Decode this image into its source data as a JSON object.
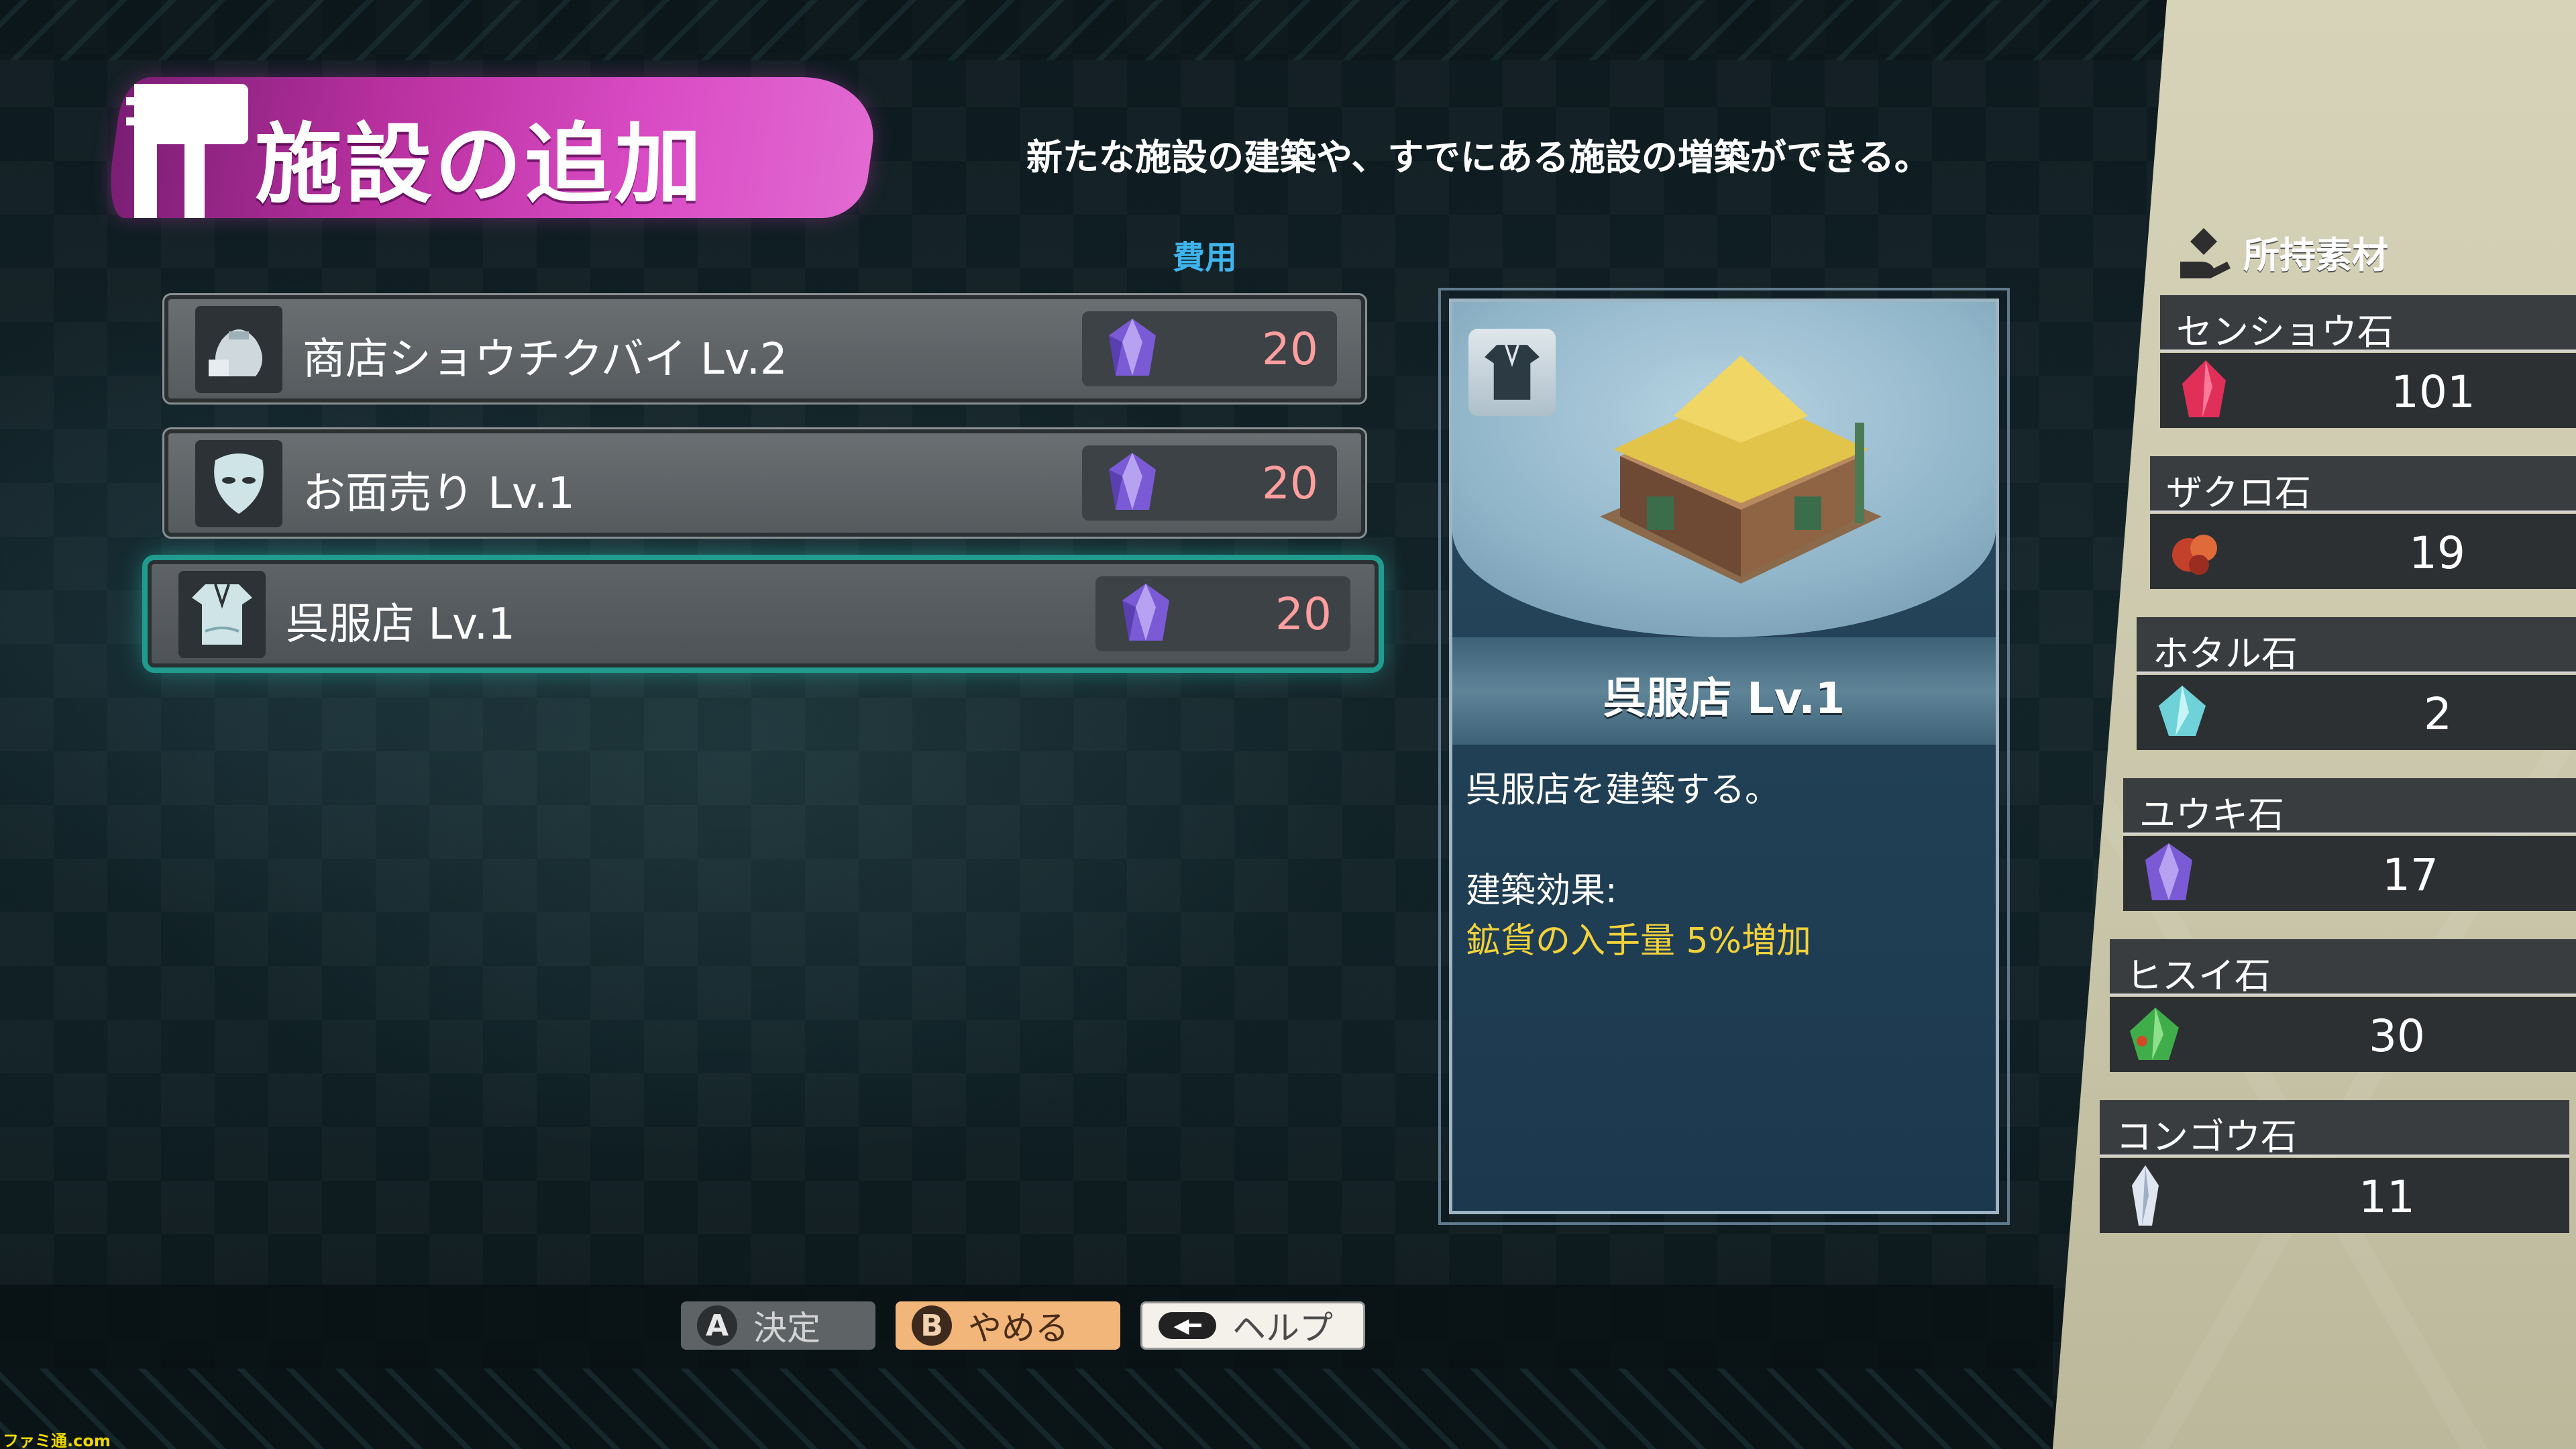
{
  "title": "施設の追加",
  "subtitle": "新たな施設の建築や、すでにある施設の増築ができる。",
  "cost_header": "費用",
  "facilities": [
    {
      "label": "商店ショウチクバイ Lv.2",
      "cost": "20",
      "icon": "bag-icon",
      "selected": false
    },
    {
      "label": "お面売り Lv.1",
      "cost": "20",
      "icon": "mask-icon",
      "selected": false
    },
    {
      "label": "呉服店 Lv.1",
      "cost": "20",
      "icon": "kimono-icon",
      "selected": true
    }
  ],
  "detail": {
    "name": "呉服店 Lv.1",
    "description": "呉服店を建築する。",
    "effect_label": "建築効果:",
    "effect_value": "鉱貨の入手量 5%増加"
  },
  "materials_header": "所持素材",
  "materials": [
    {
      "name": "センショウ石",
      "count": "101",
      "color": "#e0305a"
    },
    {
      "name": "ザクロ石",
      "count": "19",
      "color": "#c4402a"
    },
    {
      "name": "ホタル石",
      "count": "2",
      "color": "#6fd2d8"
    },
    {
      "name": "ユウキ石",
      "count": "17",
      "color": "#8a6fe0"
    },
    {
      "name": "ヒスイ石",
      "count": "30",
      "color": "#3fae4a"
    },
    {
      "name": "コンゴウ石",
      "count": "11",
      "color": "#dfe6f0"
    }
  ],
  "prompts": {
    "confirm_glyph": "A",
    "confirm_label": "決定",
    "cancel_glyph": "B",
    "cancel_label": "やめる",
    "help_label": "ヘルプ"
  },
  "colors": {
    "accent_cost": "#3fb4ec",
    "selected_glow": "#1f9c8d",
    "effect_text": "#f2d23b",
    "cost_value": "#ff9e9e"
  },
  "watermark": "ファミ通.com"
}
